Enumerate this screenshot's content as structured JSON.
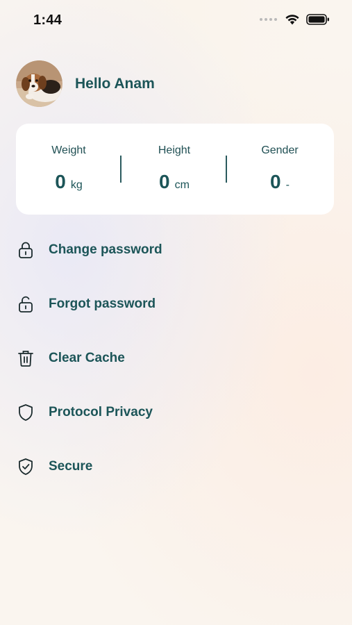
{
  "status_bar": {
    "time": "1:44",
    "icons": [
      "signal-dots-icon",
      "wifi-icon",
      "battery-icon"
    ]
  },
  "profile": {
    "greeting": "Hello Anam",
    "avatar": "puppy-photo"
  },
  "stats": [
    {
      "label": "Weight",
      "value": "0",
      "unit": "kg"
    },
    {
      "label": "Height",
      "value": "0",
      "unit": "cm"
    },
    {
      "label": "Gender",
      "value": "0",
      "unit": "-"
    }
  ],
  "menu": [
    {
      "label": "Change password",
      "icon": "lock-icon"
    },
    {
      "label": "Forgot password",
      "icon": "unlock-icon"
    },
    {
      "label": "Clear Cache",
      "icon": "trash-icon"
    },
    {
      "label": "Protocol Privacy",
      "icon": "shield-icon"
    },
    {
      "label": "Secure",
      "icon": "shield-check-icon"
    }
  ],
  "colors": {
    "primary_text": "#1c5558",
    "card_bg": "#ffffff",
    "background": "#faf5ef"
  }
}
